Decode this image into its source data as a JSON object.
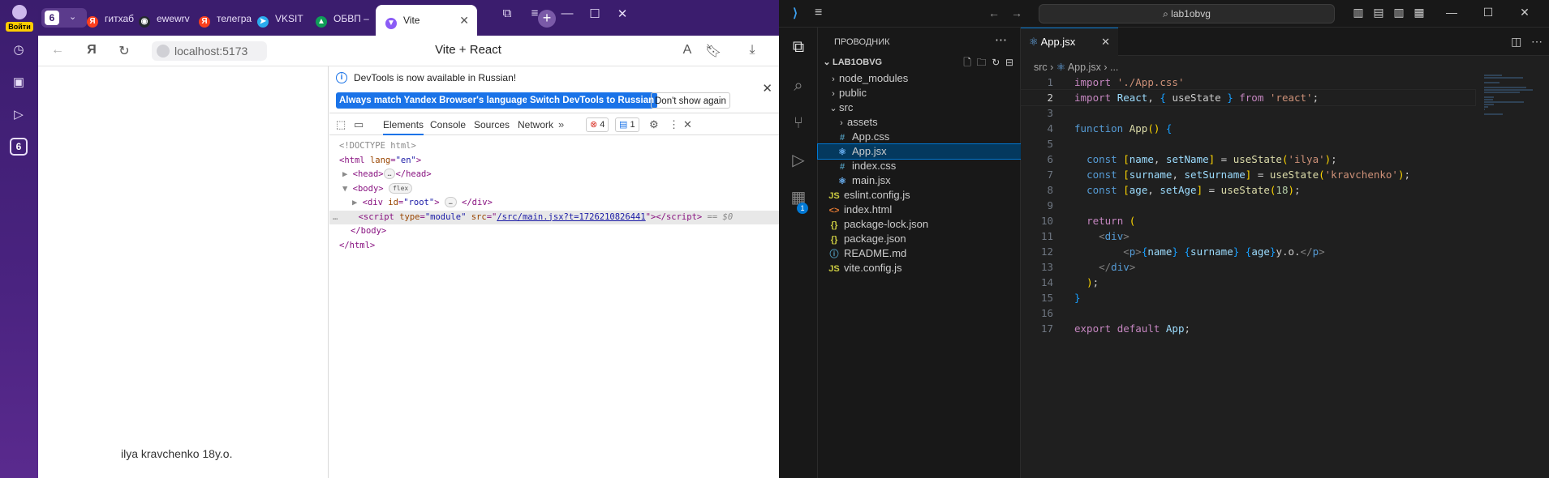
{
  "browser": {
    "sidebar": {
      "login_label": "Войти",
      "tab_count": "6"
    },
    "tabs": {
      "count": "6",
      "items": [
        {
          "label": "гитхаб",
          "fav_color": "#fc3f1d",
          "fav_glyph": "Я"
        },
        {
          "label": "ewewrv",
          "fav_color": "#24292f",
          "fav_glyph": "◉"
        },
        {
          "label": "телегра",
          "fav_color": "#fc3f1d",
          "fav_glyph": "Я"
        },
        {
          "label": "VKSIT",
          "fav_color": "#2aabee",
          "fav_glyph": "➤"
        },
        {
          "label": "ОБВП –",
          "fav_color": "#0f9d58",
          "fav_glyph": "▲"
        }
      ],
      "active": {
        "label": "Vite",
        "fav_color": "#8b5cf6",
        "fav_glyph": "▼"
      }
    },
    "address": {
      "url": "localhost:5173",
      "page_title": "Vite + React"
    },
    "page": {
      "text": "ilya kravchenko 18y.o."
    },
    "devtools": {
      "info_message": "DevTools is now available in Russian!",
      "btn_match": "Always match Yandex Browser's language",
      "btn_switch": "Switch DevTools to Russian",
      "btn_dont_show": "Don't show again",
      "tabs": [
        "Elements",
        "Console",
        "Sources",
        "Network"
      ],
      "errors": "4",
      "messages": "1",
      "dom": {
        "doctype": "<!DOCTYPE html>",
        "html_open_tag": "html",
        "html_attr": "lang",
        "html_attr_val": "\"en\"",
        "head": "head",
        "body": "body",
        "flex_pill": "flex",
        "div_attr": "id",
        "div_attr_val": "\"root\"",
        "script_type": "\"module\"",
        "script_src": "/src/main.jsx?t=1726210826441",
        "eq0": "== $0",
        "body_close": "</body>",
        "html_close": "</html>"
      }
    }
  },
  "vscode": {
    "search": "lab1obvg",
    "explorer": {
      "title": "ПРОВОДНИК",
      "root": "LAB1OBVG",
      "items": [
        {
          "label": "node_modules",
          "kind": "folder",
          "depth": 1,
          "open": false
        },
        {
          "label": "public",
          "kind": "folder",
          "depth": 1,
          "open": false
        },
        {
          "label": "src",
          "kind": "folder",
          "depth": 1,
          "open": true
        },
        {
          "label": "assets",
          "kind": "folder",
          "depth": 2,
          "open": false
        },
        {
          "label": "App.css",
          "kind": "css",
          "depth": 2
        },
        {
          "label": "App.jsx",
          "kind": "jsx",
          "depth": 2,
          "selected": true
        },
        {
          "label": "index.css",
          "kind": "css",
          "depth": 2
        },
        {
          "label": "main.jsx",
          "kind": "jsx",
          "depth": 2
        },
        {
          "label": "eslint.config.js",
          "kind": "js",
          "depth": 1
        },
        {
          "label": "index.html",
          "kind": "html",
          "depth": 1
        },
        {
          "label": "package-lock.json",
          "kind": "json",
          "depth": 1
        },
        {
          "label": "package.json",
          "kind": "json",
          "depth": 1
        },
        {
          "label": "README.md",
          "kind": "md",
          "depth": 1
        },
        {
          "label": "vite.config.js",
          "kind": "js",
          "depth": 1
        }
      ]
    },
    "editor": {
      "tab": "App.jsx",
      "breadcrumb_dir": "src",
      "breadcrumb_file": "App.jsx",
      "breadcrumb_more": "...",
      "current_line": 2,
      "lines": [
        "import './App.css'",
        "import React, { useState } from 'react';",
        "",
        "function App() {",
        "",
        "  const [name, setName] = useState('ilya');",
        "  const [surname, setSurname] = useState('kravchenko');",
        "  const [age, setAge] = useState(18);",
        "",
        "  return (",
        "    <div>",
        "        <p>{name} {surname} {age}y.o.</p>",
        "    </div>",
        "  );",
        "}",
        "",
        "export default App;"
      ]
    }
  }
}
